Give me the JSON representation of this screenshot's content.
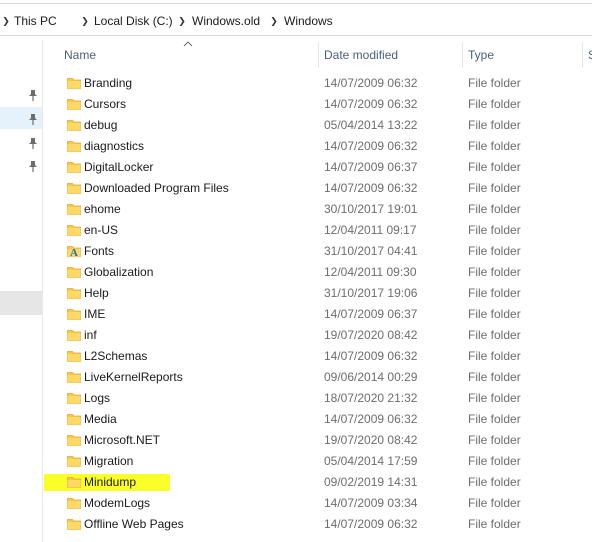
{
  "breadcrumb": [
    "This PC",
    "Local Disk (C:)",
    "Windows.old",
    "Windows"
  ],
  "columns": {
    "name": "Name",
    "date": "Date modified",
    "type": "Type",
    "size": "S"
  },
  "highlight_color": "#faff2a",
  "folders": [
    {
      "name": "Branding",
      "date": "14/07/2009 06:32",
      "type": "File folder",
      "icon": "folder-icon"
    },
    {
      "name": "Cursors",
      "date": "14/07/2009 06:32",
      "type": "File folder",
      "icon": "folder-icon"
    },
    {
      "name": "debug",
      "date": "05/04/2014 13:22",
      "type": "File folder",
      "icon": "folder-icon"
    },
    {
      "name": "diagnostics",
      "date": "14/07/2009 06:32",
      "type": "File folder",
      "icon": "folder-icon"
    },
    {
      "name": "DigitalLocker",
      "date": "14/07/2009 06:37",
      "type": "File folder",
      "icon": "folder-icon"
    },
    {
      "name": "Downloaded Program Files",
      "date": "14/07/2009 06:32",
      "type": "File folder",
      "icon": "folder-icon"
    },
    {
      "name": "ehome",
      "date": "30/10/2017 19:01",
      "type": "File folder",
      "icon": "folder-icon"
    },
    {
      "name": "en-US",
      "date": "12/04/2011 09:17",
      "type": "File folder",
      "icon": "folder-icon"
    },
    {
      "name": "Fonts",
      "date": "31/10/2017 04:41",
      "type": "File folder",
      "icon": "fonts-folder-icon"
    },
    {
      "name": "Globalization",
      "date": "12/04/2011 09:30",
      "type": "File folder",
      "icon": "folder-icon"
    },
    {
      "name": "Help",
      "date": "31/10/2017 19:06",
      "type": "File folder",
      "icon": "folder-icon"
    },
    {
      "name": "IME",
      "date": "14/07/2009 06:37",
      "type": "File folder",
      "icon": "folder-icon"
    },
    {
      "name": "inf",
      "date": "19/07/2020 08:42",
      "type": "File folder",
      "icon": "folder-icon"
    },
    {
      "name": "L2Schemas",
      "date": "14/07/2009 06:32",
      "type": "File folder",
      "icon": "folder-icon"
    },
    {
      "name": "LiveKernelReports",
      "date": "09/06/2014 00:29",
      "type": "File folder",
      "icon": "folder-icon"
    },
    {
      "name": "Logs",
      "date": "18/07/2020 21:32",
      "type": "File folder",
      "icon": "folder-icon"
    },
    {
      "name": "Media",
      "date": "14/07/2009 06:32",
      "type": "File folder",
      "icon": "folder-icon"
    },
    {
      "name": "Microsoft.NET",
      "date": "19/07/2020 08:42",
      "type": "File folder",
      "icon": "folder-icon"
    },
    {
      "name": "Migration",
      "date": "05/04/2014 17:59",
      "type": "File folder",
      "icon": "folder-icon"
    },
    {
      "name": "Minidump",
      "date": "09/02/2019 14:31",
      "type": "File folder",
      "icon": "folder-icon",
      "highlighted": true
    },
    {
      "name": "ModemLogs",
      "date": "14/07/2009 03:34",
      "type": "File folder",
      "icon": "folder-icon"
    },
    {
      "name": "Offline Web Pages",
      "date": "14/07/2009 06:32",
      "type": "File folder",
      "icon": "folder-icon"
    }
  ]
}
